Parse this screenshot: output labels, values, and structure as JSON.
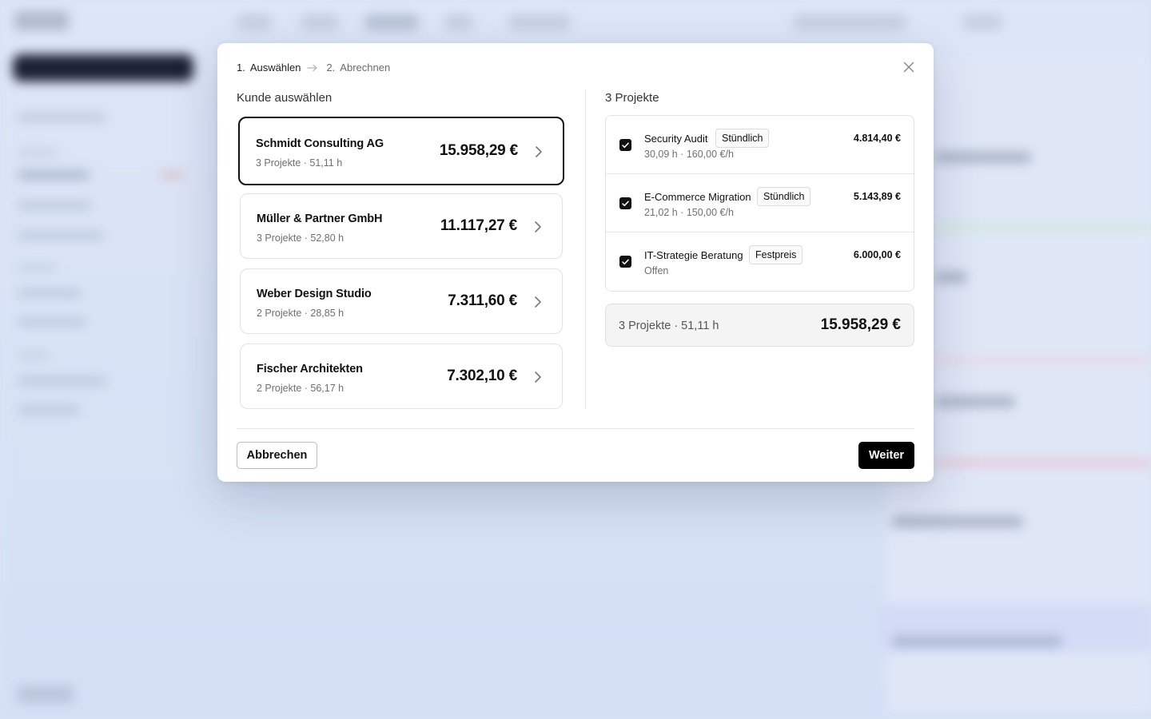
{
  "dialog": {
    "steps": [
      {
        "num": "1.",
        "label": "Auswählen"
      },
      {
        "num": "2.",
        "label": "Abrechnen"
      }
    ],
    "left_title": "Kunde auswählen",
    "right_title": "3 Projekte",
    "customers": [
      {
        "name": "Schmidt Consulting AG",
        "meta": "3 Projekte · 51,11 h",
        "amount": "15.958,29 €",
        "selected": true
      },
      {
        "name": "Müller & Partner GmbH",
        "meta": "3 Projekte · 52,80 h",
        "amount": "11.117,27 €",
        "selected": false
      },
      {
        "name": "Weber Design Studio",
        "meta": "2 Projekte · 28,85 h",
        "amount": "7.311,60 €",
        "selected": false
      },
      {
        "name": "Fischer Architekten",
        "meta": "2 Projekte · 56,17 h",
        "amount": "7.302,10 €",
        "selected": false
      }
    ],
    "projects": [
      {
        "name": "Security Audit",
        "badge": "Stündlich",
        "meta": "30,09 h · 160,00 €/h",
        "amount": "4.814,40 €",
        "checked": true
      },
      {
        "name": "E-Commerce Migration",
        "badge": "Stündlich",
        "meta": "21,02 h · 150,00 €/h",
        "amount": "5.143,89 €",
        "checked": true
      },
      {
        "name": "IT-Strategie Beratung",
        "badge": "Festpreis",
        "meta": "Offen",
        "amount": "6.000,00 €",
        "checked": true
      }
    ],
    "summary": {
      "label": "3 Projekte · 51,11 h",
      "amount": "15.958,29 €"
    },
    "cancel_label": "Abbrechen",
    "next_label": "Weiter"
  },
  "colors": {
    "accent": "#000000",
    "backdrop": "#d9e3f5"
  }
}
